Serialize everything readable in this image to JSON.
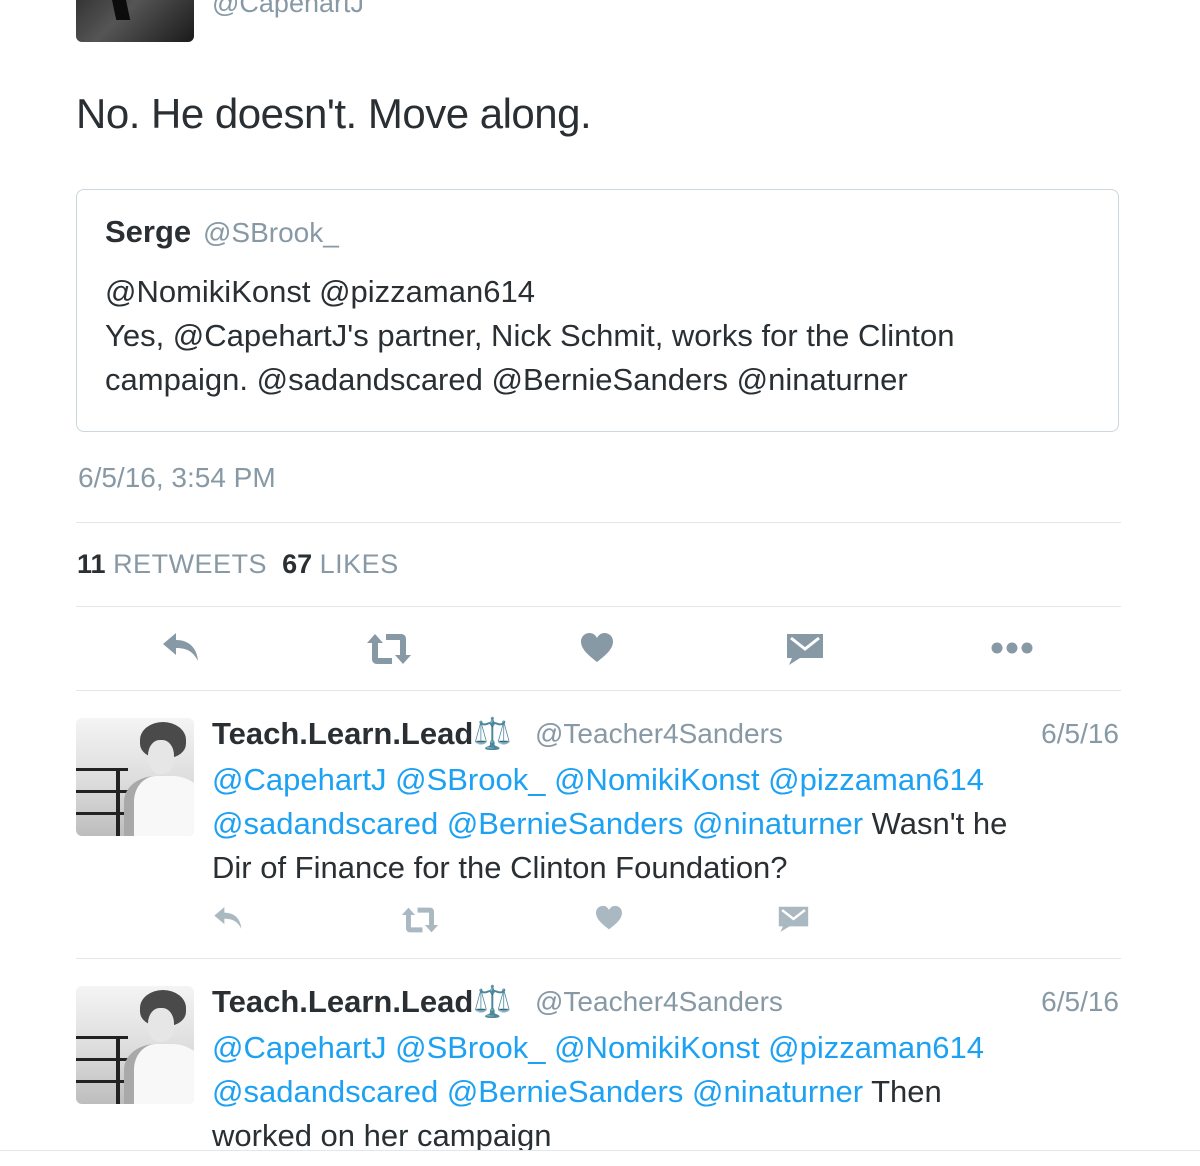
{
  "top_tweet": {
    "handle": "@CapehartJ",
    "text": "No. He doesn't. Move along.",
    "quoted": {
      "name": "Serge",
      "handle": "@SBrook_",
      "lines": [
        "@NomikiKonst @pizzaman614",
        "Yes, @CapehartJ's partner, Nick Schmit, works for the Clinton",
        "campaign. @sadandscared @BernieSanders @ninaturner"
      ]
    },
    "timestamp": "6/5/16, 3:54 PM",
    "retweets_count": "11",
    "retweets_label": "RETWEETS",
    "likes_count": "67",
    "likes_label": "LIKES"
  },
  "replies": [
    {
      "name": "Teach.Learn.Lead⚖️",
      "handle": "@Teacher4Sanders",
      "date": "6/5/16",
      "line1": "@CapehartJ @SBrook_ @NomikiKonst @pizzaman614",
      "line2_mentions": "@sadandscared @BernieSanders @ninaturner",
      "line2_text": " Wasn't he",
      "line3": "Dir of Finance for the Clinton Foundation?"
    },
    {
      "name": "Teach.Learn.Lead⚖️",
      "handle": "@Teacher4Sanders",
      "date": "6/5/16",
      "line1": "@CapehartJ @SBrook_ @NomikiKonst @pizzaman614",
      "line2_mentions": "@sadandscared @BernieSanders @ninaturner",
      "line2_text": " Then",
      "line3": "worked on her campaign"
    }
  ],
  "icons": {
    "reply": "reply-icon",
    "retweet": "retweet-icon",
    "like": "heart-icon",
    "dm": "envelope-icon",
    "more": "more-icon"
  },
  "colors": {
    "text": "#292f33",
    "muted": "#8899a6",
    "mention": "#1da1f2",
    "border": "#e1e8ed"
  }
}
